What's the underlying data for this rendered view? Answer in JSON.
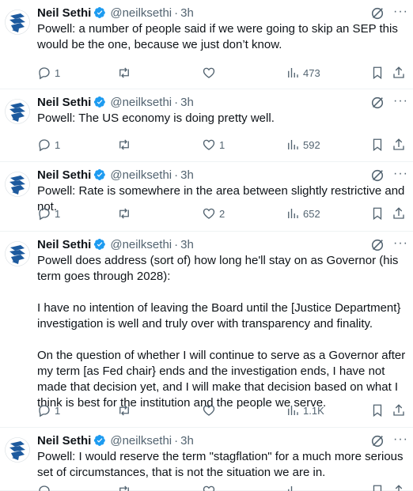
{
  "tweets": [
    {
      "name": "Neil Sethi",
      "handle": "@neilksethi",
      "time": "3h",
      "text": "Powell: a number of people said if we were going to skip an SEP this would be the one, because we just don’t know.",
      "replies": "1",
      "retweets": "",
      "likes": "",
      "views": "473"
    },
    {
      "name": "Neil Sethi",
      "handle": "@neilksethi",
      "time": "3h",
      "text": "Powell: The US economy is doing pretty well.",
      "replies": "1",
      "retweets": "",
      "likes": "1",
      "views": "592"
    },
    {
      "name": "Neil Sethi",
      "handle": "@neilksethi",
      "time": "3h",
      "text": "Powell: Rate is somewhere in the area between slightly restrictive and not.",
      "replies": "1",
      "retweets": "",
      "likes": "2",
      "views": "652"
    },
    {
      "name": "Neil Sethi",
      "handle": "@neilksethi",
      "time": "3h",
      "text": "Powell does address (sort of) how long he'll stay on as Governor (his term goes through 2028):\n\nI have no intention of leaving the Board until the [Justice Department} investigation is well and truly over with transparency and finality.\n\nOn the question of whether I will continue to serve as a Governor after my term [as Fed chair} ends and the investigation ends, I have not made that decision yet, and I will make that decision based on what I think is best for the institution and the people we serve.",
      "replies": "1",
      "retweets": "",
      "likes": "",
      "views": "1.1K"
    },
    {
      "name": "Neil Sethi",
      "handle": "@neilksethi",
      "time": "3h",
      "text": "Powell: I would reserve the term \"stagflation\" for a much more serious set of circumstances, that is not the situation we are in.",
      "replies": "",
      "retweets": "",
      "likes": "",
      "views": ""
    }
  ],
  "colors": {
    "text": "#0f1419",
    "secondary": "#536471",
    "verified": "#1d9bf0",
    "divider": "#eff3f4",
    "avatar_logo": "#1d5a9e"
  },
  "icons": [
    "avatar-logo",
    "verified-badge-icon",
    "grok-icon",
    "more-icon",
    "reply-icon",
    "retweet-icon",
    "like-icon",
    "views-icon",
    "bookmark-icon",
    "share-icon"
  ]
}
